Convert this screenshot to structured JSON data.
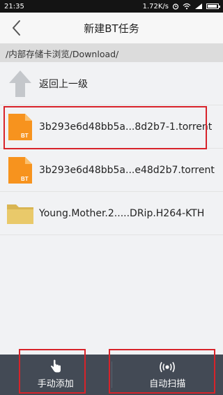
{
  "status_bar": {
    "time": "21:35",
    "network_speed": "1.72K/s",
    "battery_level": 0.85
  },
  "header": {
    "title": "新建BT任务",
    "back_icon": "chevron-left-icon"
  },
  "path_bar": {
    "path": "/内部存储卡浏览/Download/"
  },
  "list": {
    "items": [
      {
        "label": "返回上一级",
        "icon": "up-arrow-icon",
        "type": "parent"
      },
      {
        "label": "3b293e6d48bb5a...8d2b7-1.torrent",
        "icon": "bt-file-icon",
        "type": "torrent",
        "highlighted": true
      },
      {
        "label": "3b293e6d48bb5a...e48d2b7.torrent",
        "icon": "bt-file-icon",
        "type": "torrent",
        "highlighted": false
      },
      {
        "label": "Young.Mother.2.....DRip.H264-KTH",
        "icon": "folder-icon",
        "type": "folder",
        "highlighted": false
      }
    ]
  },
  "bottom_bar": {
    "manual_add": "手动添加",
    "auto_scan": "自动扫描"
  },
  "colors": {
    "accent_orange": "#f7931e",
    "highlight_red": "#d8232a",
    "bottom_bar": "#434a55",
    "folder": "#e9c96a"
  }
}
